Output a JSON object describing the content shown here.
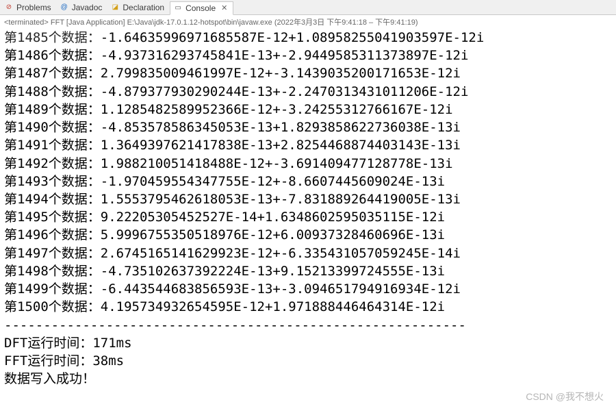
{
  "tabs": {
    "problems": {
      "label": "Problems"
    },
    "javadoc": {
      "label": "Javadoc"
    },
    "declaration": {
      "label": "Declaration"
    },
    "console": {
      "label": "Console"
    }
  },
  "status": {
    "terminated": "<terminated>",
    "app": "FFT [Java Application]",
    "path": "E:\\Java\\jdk-17.0.1.12-hotspot\\bin\\javaw.exe",
    "time": "(2022年3月3日 下午9:41:18 – 下午9:41:19)"
  },
  "rows": [
    {
      "idx": "1485",
      "val": "-1.64635996971685587E-12+1.08958255041903597E-12i"
    },
    {
      "idx": "1486",
      "val": "-4.937316293745841E-13+-2.9449585311373897E-12i"
    },
    {
      "idx": "1487",
      "val": "2.799835009461997E-12+-3.1439035200171653E-12i"
    },
    {
      "idx": "1488",
      "val": "-4.879377930290244E-13+-2.2470313431011206E-12i"
    },
    {
      "idx": "1489",
      "val": "1.1285482589952366E-12+-3.24255312766167E-12i"
    },
    {
      "idx": "1490",
      "val": "-4.853578586345053E-13+1.8293858622736038E-13i"
    },
    {
      "idx": "1491",
      "val": "1.3649397621417838E-13+2.8254468874403143E-13i"
    },
    {
      "idx": "1492",
      "val": "1.988210051418488E-12+-3.691409477128778E-13i"
    },
    {
      "idx": "1493",
      "val": "-1.970459554347755E-12+-8.6607445609024E-13i"
    },
    {
      "idx": "1494",
      "val": "1.5553795462618053E-13+-7.831889264419005E-13i"
    },
    {
      "idx": "1495",
      "val": "9.22205305452527E-14+1.6348602595035115E-12i"
    },
    {
      "idx": "1496",
      "val": "5.9996755350518976E-12+6.00937328460696E-13i"
    },
    {
      "idx": "1497",
      "val": "2.6745165141629923E-12+-6.335431057059245E-14i"
    },
    {
      "idx": "1498",
      "val": "-4.735102637392224E-13+9.15213399724555E-13i"
    },
    {
      "idx": "1499",
      "val": "-6.443544683856593E-13+-3.094651794916934E-12i"
    },
    {
      "idx": "1500",
      "val": "4.195734932654595E-12+1.971888446464314E-12i"
    }
  ],
  "label": {
    "prefix": "第",
    "suffix": "个数据："
  },
  "divider": "-----------------------------------------------------------",
  "summary": {
    "dft_label": "DFT运行时间：",
    "dft_value": "171ms",
    "fft_label": "FFT运行时间：",
    "fft_value": "38ms",
    "done": "数据写入成功！"
  },
  "watermark": "CSDN @我不想火"
}
